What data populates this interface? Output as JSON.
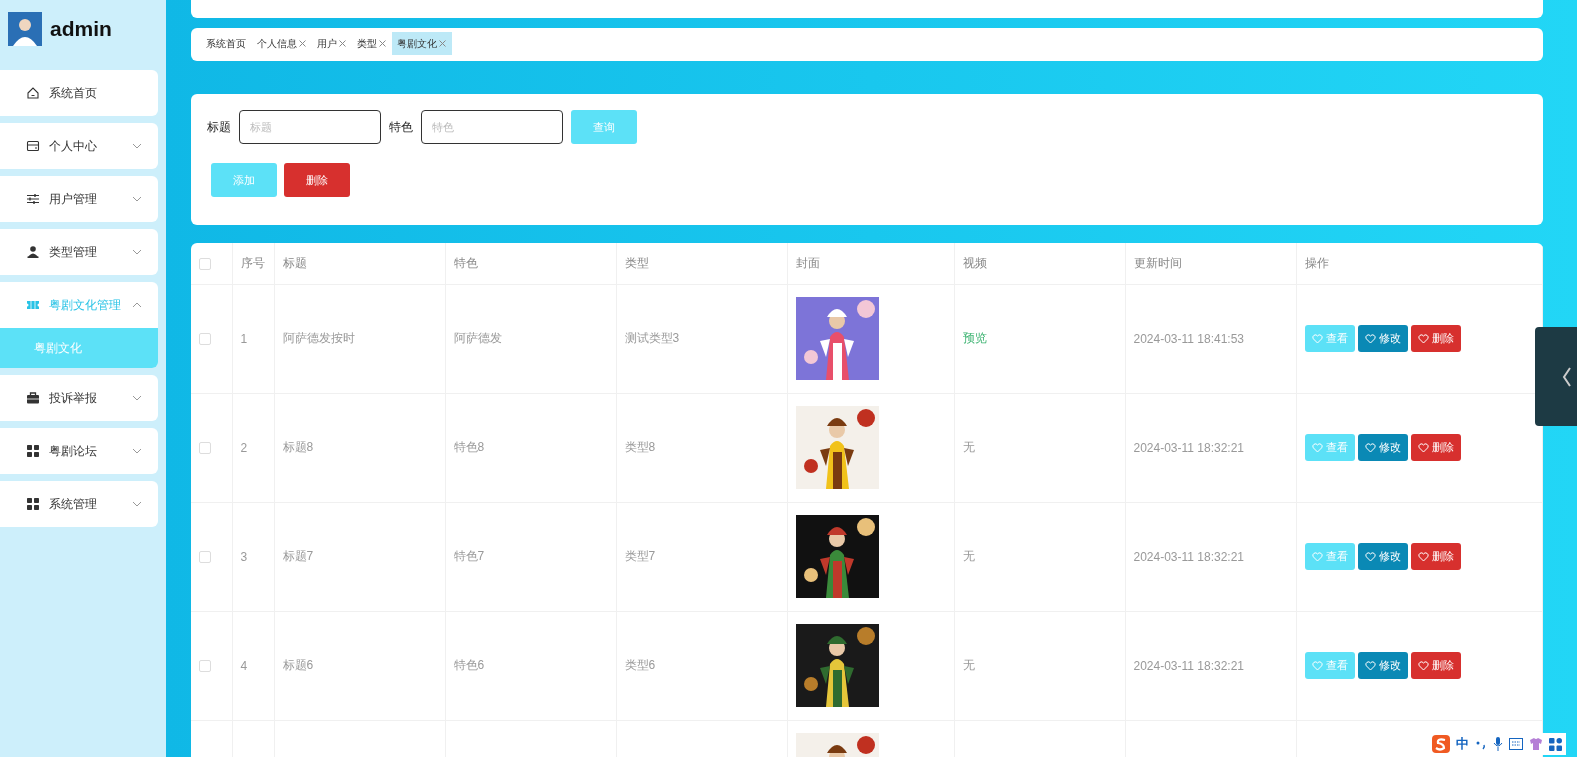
{
  "user": {
    "name": "admin"
  },
  "sidebar": {
    "items": [
      {
        "label": "系统首页",
        "selected": false
      },
      {
        "label": "个人中心",
        "expanded": false,
        "selected": false
      },
      {
        "label": "用户管理",
        "expanded": false,
        "selected": false
      },
      {
        "label": "类型管理",
        "expanded": false,
        "selected": false
      },
      {
        "label": "粤剧文化管理",
        "expanded": true,
        "selected": true,
        "children": [
          {
            "label": "粤剧文化",
            "selected": true
          }
        ]
      },
      {
        "label": "投诉举报",
        "expanded": false,
        "selected": false
      },
      {
        "label": "粤剧论坛",
        "expanded": false,
        "selected": false
      },
      {
        "label": "系统管理",
        "expanded": false,
        "selected": false
      }
    ]
  },
  "tabs": [
    {
      "label": "系统首页",
      "selected": false
    },
    {
      "label": "个人信息",
      "closable": true,
      "selected": false
    },
    {
      "label": "用户",
      "closable": true,
      "selected": false
    },
    {
      "label": "类型",
      "closable": true,
      "selected": false
    },
    {
      "label": "粤剧文化",
      "closable": true,
      "selected": true
    }
  ],
  "search": {
    "fields": [
      {
        "label": "标题",
        "placeholder": "标题"
      },
      {
        "label": "特色",
        "placeholder": "特色"
      }
    ],
    "query_button": "查询",
    "add_button": "添加",
    "delete_button": "删除"
  },
  "table": {
    "header_checked": false,
    "columns": [
      "序号",
      "标题",
      "特色",
      "类型",
      "封面",
      "视频",
      "更新时间",
      "操作"
    ],
    "rows": [
      {
        "checked": false,
        "index": "1",
        "title": "阿萨德发按时",
        "feature": "阿萨德发",
        "type": "测试类型3",
        "cover": {
          "kind": "picture"
        },
        "video": {
          "kind": "link",
          "text": "预览"
        },
        "updated": "2024-03-11 18:41:53",
        "actions": [
          {
            "kind": "view",
            "label": "查看"
          },
          {
            "kind": "edit",
            "label": "修改"
          },
          {
            "kind": "delete",
            "label": "删除"
          }
        ]
      },
      {
        "checked": false,
        "index": "2",
        "title": "标题8",
        "feature": "特色8",
        "type": "类型8",
        "cover": {
          "kind": "picture"
        },
        "video": {
          "kind": "none",
          "text": "无"
        },
        "updated": "2024-03-11 18:32:21",
        "actions": [
          {
            "kind": "view",
            "label": "查看"
          },
          {
            "kind": "edit",
            "label": "修改"
          },
          {
            "kind": "delete",
            "label": "删除"
          }
        ]
      },
      {
        "checked": false,
        "index": "3",
        "title": "标题7",
        "feature": "特色7",
        "type": "类型7",
        "cover": {
          "kind": "picture"
        },
        "video": {
          "kind": "none",
          "text": "无"
        },
        "updated": "2024-03-11 18:32:21",
        "actions": [
          {
            "kind": "view",
            "label": "查看"
          },
          {
            "kind": "edit",
            "label": "修改"
          },
          {
            "kind": "delete",
            "label": "删除"
          }
        ]
      },
      {
        "checked": false,
        "index": "4",
        "title": "标题6",
        "feature": "特色6",
        "type": "类型6",
        "cover": {
          "kind": "picture"
        },
        "video": {
          "kind": "none",
          "text": "无"
        },
        "updated": "2024-03-11 18:32:21",
        "actions": [
          {
            "kind": "view",
            "label": "查看"
          },
          {
            "kind": "edit",
            "label": "修改"
          },
          {
            "kind": "delete",
            "label": "删除"
          }
        ]
      },
      {
        "cover": {
          "kind": "picture"
        }
      }
    ]
  },
  "ime_toolbar": {
    "mode": "中"
  }
}
